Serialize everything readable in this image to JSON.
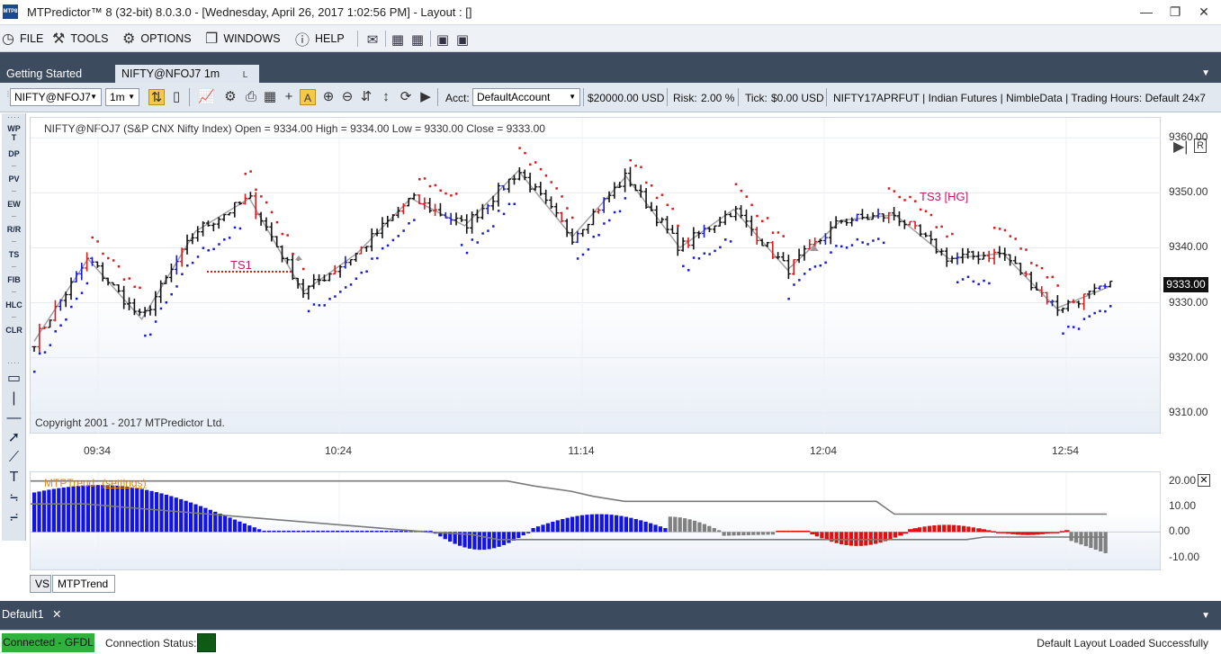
{
  "window": {
    "app_icon_text": "MTP8",
    "title": "MTPredictor™ 8 (32-bit) 8.0.3.0 - [Wednesday, April 26, 2017 1:02:56 PM]  - Layout : []"
  },
  "menu": {
    "items": [
      {
        "label": "FILE",
        "icon": "file-icon"
      },
      {
        "label": "TOOLS",
        "icon": "tools-icon"
      },
      {
        "label": "OPTIONS",
        "icon": "gear-icon"
      },
      {
        "label": "WINDOWS",
        "icon": "window-icon"
      },
      {
        "label": "HELP",
        "icon": "help-icon"
      }
    ]
  },
  "tabs": {
    "items": [
      {
        "label": "Getting Started",
        "active": false
      },
      {
        "label": "NIFTY@NFOJ7 1m",
        "active": true
      }
    ]
  },
  "toolbar": {
    "symbol": "NIFTY@NFOJ7",
    "interval": "1m",
    "acct_label": "Acct:",
    "account": "DefaultAccount",
    "balance": "$20000.00  USD",
    "risk_label": "Risk:",
    "risk": "2.00 %",
    "tick_label": "Tick:",
    "tick": "$0.00 USD",
    "info": "NIFTY17APRFUT | Indian Futures | NimbleData | Trading Hours: Default 24x7"
  },
  "palette": {
    "buttons": [
      "WP",
      "DP",
      "PV",
      "EW",
      "R/R",
      "TS",
      "FIB",
      "HLC",
      "CLR"
    ]
  },
  "chart": {
    "header": "NIFTY@NFOJ7 (S&P CNX Nifty Index) Open = 9334.00 High = 9334.00 Low = 9330.00 Close = 9333.00",
    "copyright": "Copyright 2001 - 2017 MTPredictor Ltd.",
    "last_price": "9333.00",
    "annotations": [
      "TS1",
      "TS3 [HG]"
    ]
  },
  "indicator": {
    "name": "MTPTrend",
    "settings": "(settings)",
    "y_ticks": [
      "20.00",
      "10.00",
      "0.00",
      "-10.00"
    ]
  },
  "panel_tabs": [
    "VS",
    "MTPTrend"
  ],
  "layout_tab": "Default1",
  "status": {
    "connected": "Connected - GFDL",
    "connection_label": "Connection Status:",
    "message": "Default Layout Loaded Successfully"
  },
  "chart_data": {
    "type": "bar",
    "title": "NIFTY@NFOJ7 (S&P CNX Nifty Index)",
    "x_ticks": [
      "09:34",
      "10:24",
      "11:14",
      "12:04",
      "12:54"
    ],
    "y_ticks": [
      9360,
      9350,
      9340,
      9330,
      9320,
      9310
    ],
    "ylim": [
      9308,
      9362
    ],
    "y_tick_labels": [
      "9360.00",
      "9350.00",
      "9340.00",
      "9330.00",
      "9320.00",
      "9310.00"
    ],
    "ohlc_last": {
      "open": 9334.0,
      "high": 9334.0,
      "low": 9330.0,
      "close": 9333.0
    },
    "swing_line": [
      9323,
      9338,
      9327,
      9343,
      9349,
      9332,
      9339,
      9349,
      9344,
      9354,
      9342,
      9353,
      9340,
      9347,
      9336,
      9345,
      9346,
      9338,
      9339,
      9329,
      9333
    ],
    "indicator_zero_line": 0
  }
}
